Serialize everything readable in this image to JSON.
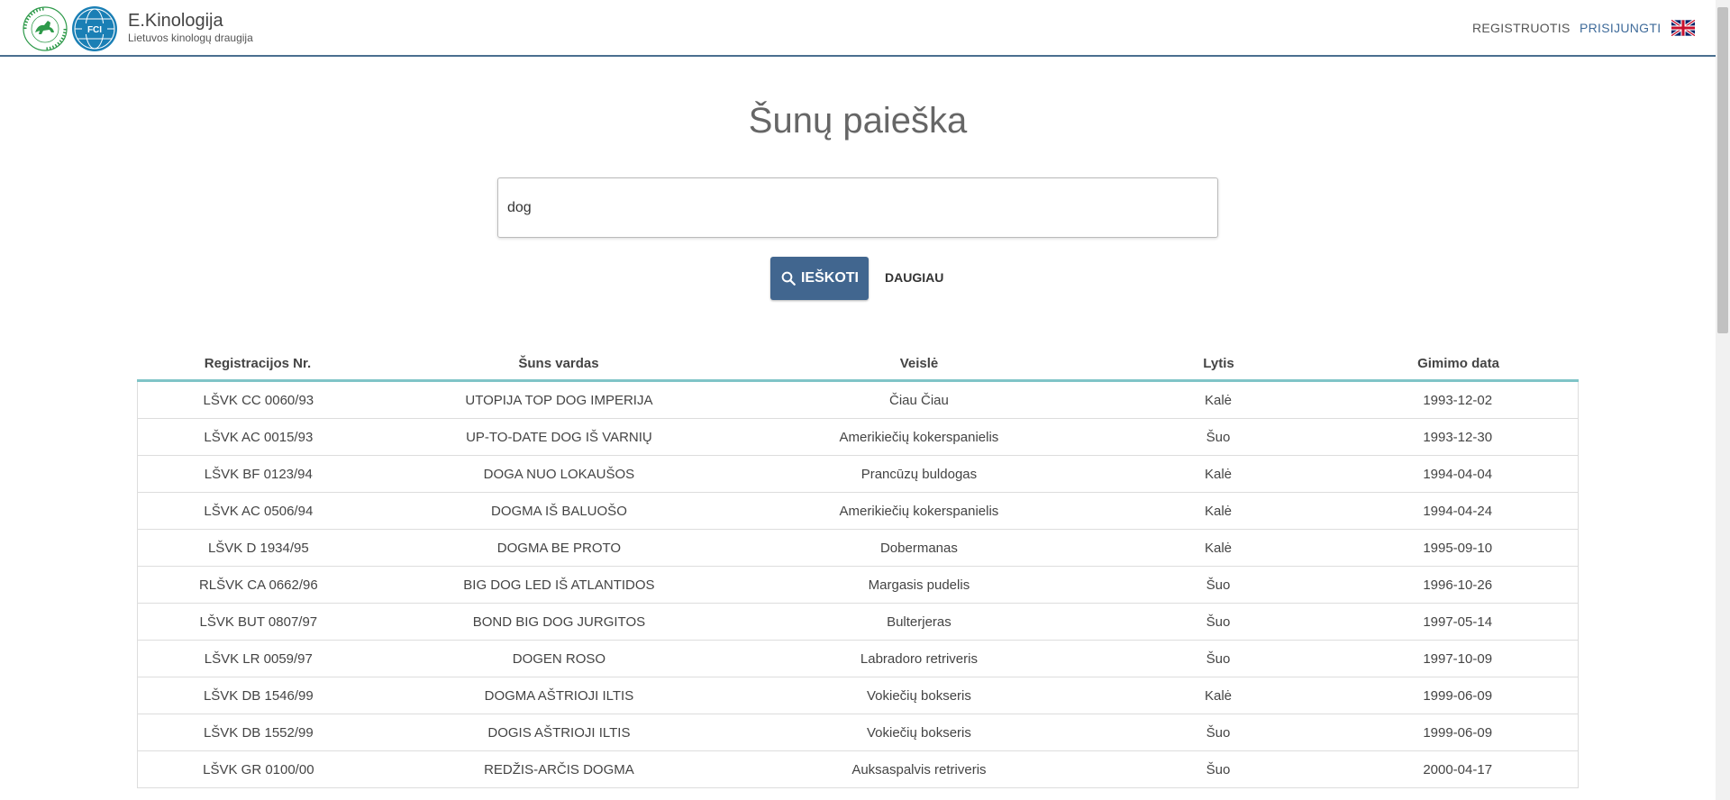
{
  "header": {
    "brand_title": "E.Kinologija",
    "brand_subtitle": "Lietuvos kinologų draugija",
    "register_label": "REGISTRUOTIS",
    "login_label": "PRISIJUNGTI",
    "lkd_logo_text": "LIETUVOS KINOLOGŲ DRAUGIJA",
    "fci_logo_text": "FCI",
    "language_icon": "uk-flag-icon"
  },
  "search": {
    "title": "Šunų paieška",
    "query": "dog",
    "button_label": "IEŠKOTI",
    "more_label": "DAUGIAU"
  },
  "table": {
    "columns": [
      "Registracijos Nr.",
      "Šuns vardas",
      "Veislė",
      "Lytis",
      "Gimimo data"
    ],
    "rows": [
      [
        "LŠVK CC 0060/93",
        "UTOPIJA TOP DOG IMPERIJA",
        "Čiau Čiau",
        "Kalė",
        "1993-12-02"
      ],
      [
        "LŠVK AC 0015/93",
        "UP-TO-DATE DOG IŠ VARNIŲ",
        "Amerikiečių kokerspanielis",
        "Šuo",
        "1993-12-30"
      ],
      [
        "LŠVK BF 0123/94",
        "DOGA NUO LOKAUŠOS",
        "Prancūzų buldogas",
        "Kalė",
        "1994-04-04"
      ],
      [
        "LŠVK AC 0506/94",
        "DOGMA IŠ BALUOŠO",
        "Amerikiečių kokerspanielis",
        "Kalė",
        "1994-04-24"
      ],
      [
        "LŠVK D 1934/95",
        "DOGMA BE PROTO",
        "Dobermanas",
        "Kalė",
        "1995-09-10"
      ],
      [
        "RLŠVK CA 0662/96",
        "BIG DOG LED IŠ ATLANTIDOS",
        "Margasis pudelis",
        "Šuo",
        "1996-10-26"
      ],
      [
        "LŠVK BUT 0807/97",
        "BOND BIG DOG JURGITOS",
        "Bulterjeras",
        "Šuo",
        "1997-05-14"
      ],
      [
        "LŠVK LR 0059/97",
        "DOGEN ROSO",
        "Labradoro retriveris",
        "Šuo",
        "1997-10-09"
      ],
      [
        "LŠVK DB 1546/99",
        "DOGMA AŠTRIOJI ILTIS",
        "Vokiečių bokseris",
        "Kalė",
        "1999-06-09"
      ],
      [
        "LŠVK DB 1552/99",
        "DOGIS AŠTRIOJI ILTIS",
        "Vokiečių bokseris",
        "Šuo",
        "1999-06-09"
      ],
      [
        "LŠVK GR 0100/00",
        "REDŽIS-ARČIS DOGMA",
        "Auksaspalvis retriveris",
        "Šuo",
        "2000-04-17"
      ]
    ]
  },
  "colors": {
    "primary": "#41668f",
    "accent_border": "#7fc4c7",
    "logo_green": "#2e9a4a",
    "logo_blue": "#1a7fb5"
  }
}
